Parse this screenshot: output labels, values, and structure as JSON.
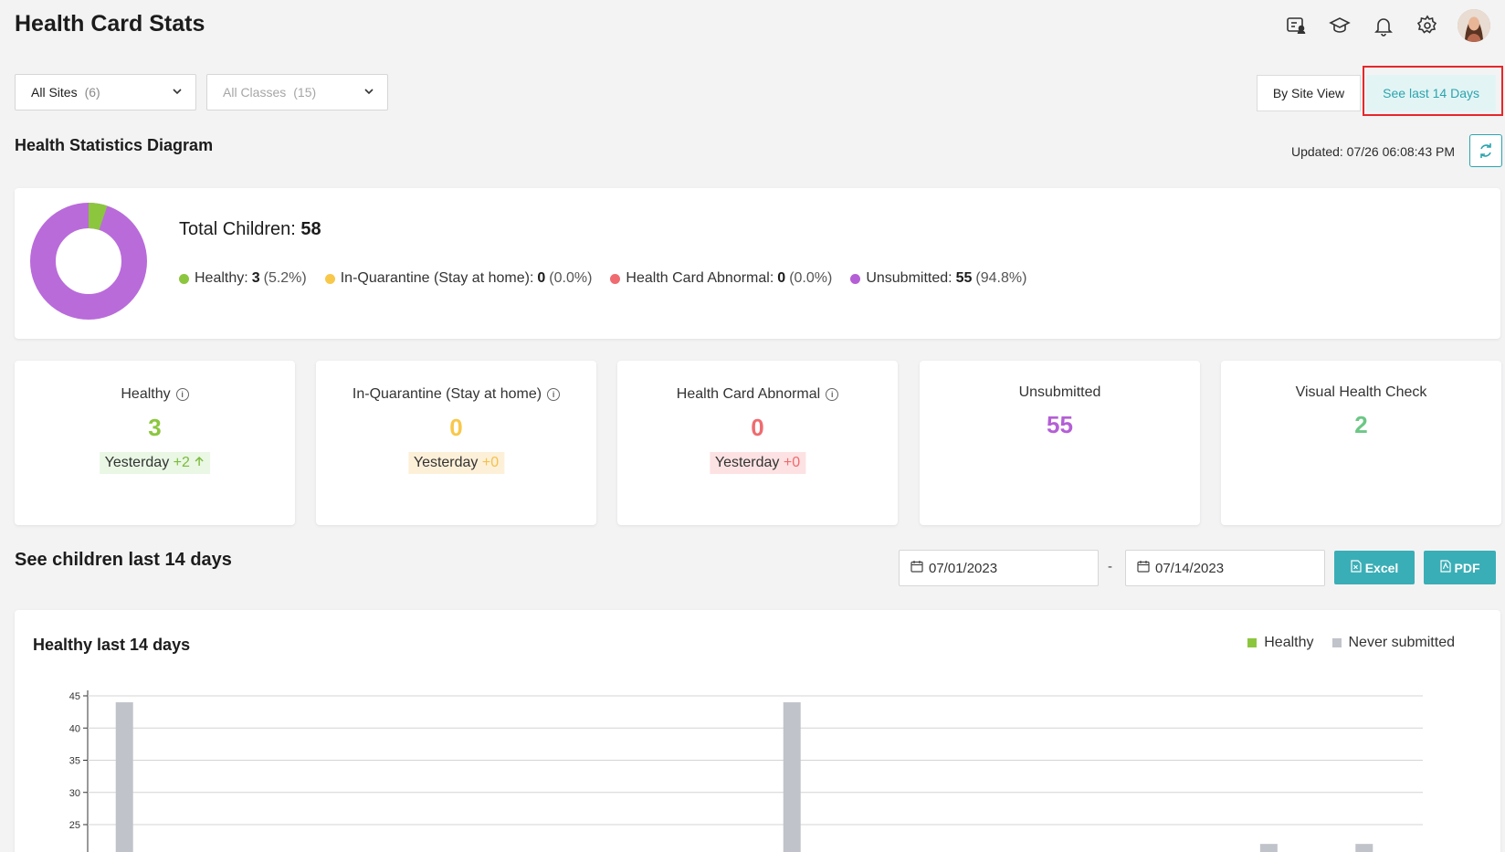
{
  "page": {
    "title": "Health Card Stats"
  },
  "header_icons": [
    "chat-person-icon",
    "graduation-cap-icon",
    "bell-icon",
    "gear-icon"
  ],
  "filters": {
    "sites": {
      "label": "All Sites",
      "count": "(6)"
    },
    "classes": {
      "label": "All Classes",
      "count": "(15)"
    }
  },
  "view_toggle": {
    "by_site": "By Site View",
    "last14": "See last 14 Days"
  },
  "stats_section": {
    "title": "Health Statistics Diagram",
    "updated": "Updated: 07/26 06:08:43 PM"
  },
  "summary": {
    "total_label": "Total Children:",
    "total_value": "58",
    "legend": [
      {
        "label": "Healthy:",
        "value": "3",
        "pct": "(5.2%)",
        "color": "#8cc63f"
      },
      {
        "label": "In-Quarantine (Stay at home):",
        "value": "0",
        "pct": "(0.0%)",
        "color": "#f8c84a"
      },
      {
        "label": "Health Card Abnormal:",
        "value": "0",
        "pct": "(0.0%)",
        "color": "#ef6b6f"
      },
      {
        "label": "Unsubmitted:",
        "value": "55",
        "pct": "(94.8%)",
        "color": "#b45fd6"
      }
    ]
  },
  "stats": [
    {
      "title": "Healthy",
      "value": "3",
      "color": "#8cc63f",
      "yest_label": "Yesterday",
      "yest_delta": "+2",
      "yest_bg": "#e9f7e4",
      "yest_color": "#7abb3a"
    },
    {
      "title": "In-Quarantine (Stay at home)",
      "value": "0",
      "color": "#f8c84a",
      "yest_label": "Yesterday",
      "yest_delta": "+0",
      "yest_bg": "#fdf0d8",
      "yest_color": "#f5c04c"
    },
    {
      "title": "Health Card Abnormal",
      "value": "0",
      "color": "#ef6b6f",
      "yest_label": "Yesterday",
      "yest_delta": "+0",
      "yest_bg": "#fde2e3",
      "yest_color": "#ef6b6f"
    },
    {
      "title": "Unsubmitted",
      "value": "55",
      "color": "#b45fd6"
    },
    {
      "title": "Visual Health Check",
      "value": "2",
      "color": "#6cc785"
    }
  ],
  "range_section": {
    "title": "See children last 14 days",
    "from": "07/01/2023",
    "dash": "-",
    "to": "07/14/2023",
    "excel": "Excel",
    "pdf": "PDF"
  },
  "chart_data": {
    "type": "bar",
    "title": "Healthy last 14 days",
    "series": [
      {
        "name": "Healthy",
        "color": "#8cc63f",
        "values": [
          0,
          0,
          0,
          0,
          0,
          0,
          0,
          0,
          0,
          0,
          0,
          0,
          0,
          0
        ]
      },
      {
        "name": "Never submitted",
        "color": "#c0c3ca",
        "values": [
          44,
          0,
          0,
          0,
          0,
          0,
          0,
          44,
          0,
          0,
          0,
          0,
          22,
          22
        ]
      }
    ],
    "yticks": [
      25,
      30,
      35,
      40,
      45
    ],
    "ylim": [
      25,
      45
    ]
  }
}
